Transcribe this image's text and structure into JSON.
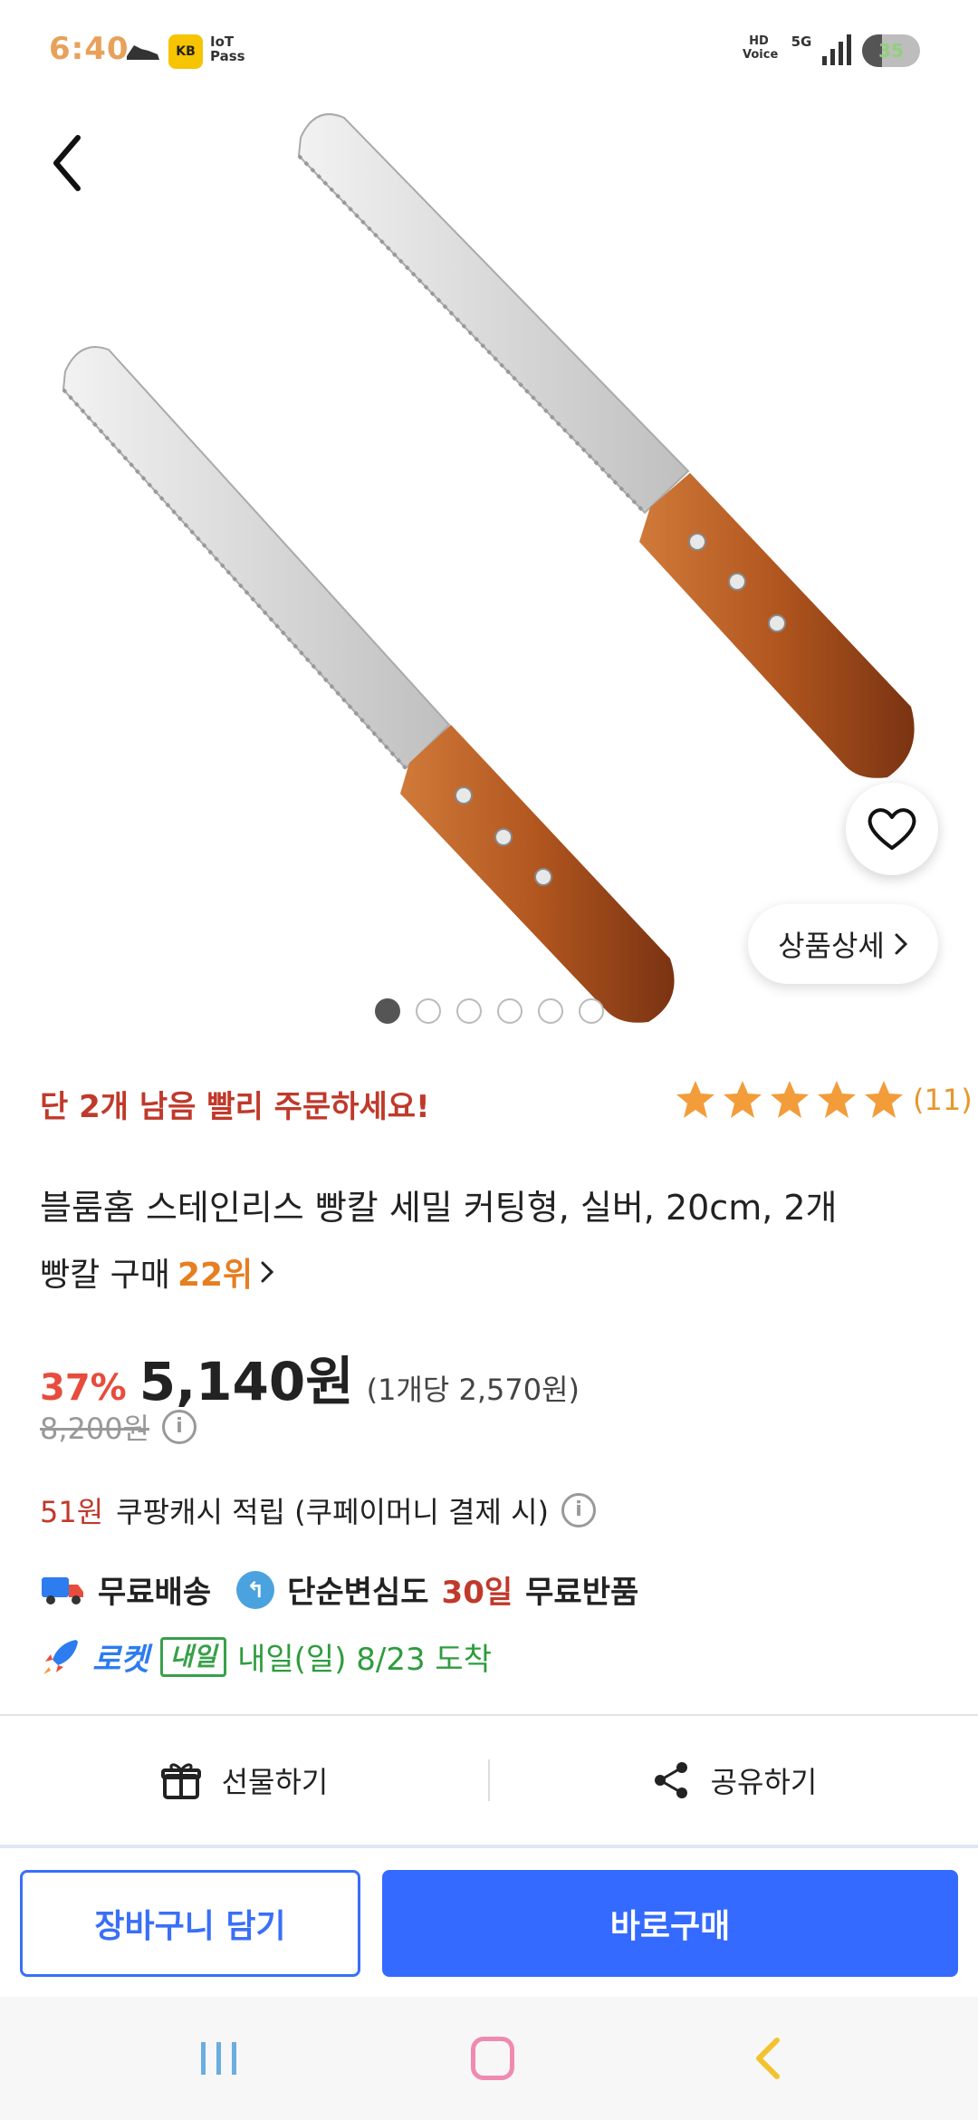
{
  "status_bar": {
    "time": "6:40",
    "kb_label": "KB",
    "iot_label": "IoT Pass",
    "hd_label": "HD Voice",
    "network_label": "5G",
    "battery_level": "35"
  },
  "product": {
    "image_pager": {
      "count": 6,
      "active_index": 0
    },
    "detail_button_label": "상품상세",
    "stock_alert": "단 2개 남음 빨리 주문하세요!",
    "rating": {
      "stars": 5,
      "review_count": "(11)"
    },
    "title": "블룸홈 스테인리스 빵칼 세밀 커팅형, 실버, 20cm, 2개",
    "rank_label": "빵칼 구매",
    "rank_value": "22위",
    "discount_rate": "37%",
    "sale_price": "5,140원",
    "unit_price": "(1개당 2,570원)",
    "original_price": "8,200원",
    "cash_back_amount": "51원",
    "cash_back_text": "쿠팡캐시 적립 (쿠페이머니 결제 시)",
    "free_shipping": "무료배송",
    "return_policy_prefix": "단순변심도",
    "return_policy_days": "30일",
    "return_policy_suffix": "무료반품",
    "rocket_label": "로켓",
    "rocket_badge": "내일",
    "arrival": "내일(일) 8/23 도착"
  },
  "actions": {
    "gift_label": "선물하기",
    "share_label": "공유하기"
  },
  "cta": {
    "cart_label": "장바구니 담기",
    "buy_label": "바로구매"
  },
  "colors": {
    "accent_blue": "#346aff",
    "alert_red": "#c0392b",
    "star_orange": "#f39c3a",
    "rocket_green": "#38a04a"
  }
}
